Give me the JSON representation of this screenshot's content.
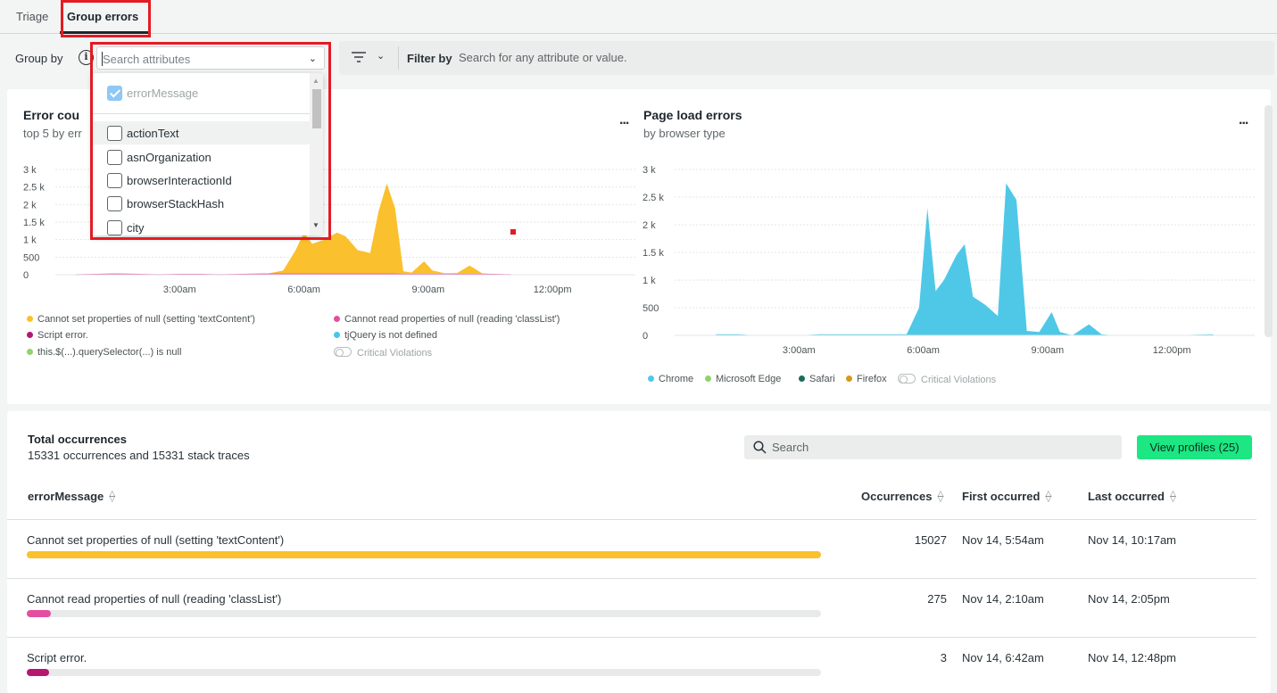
{
  "tabs": [
    {
      "label": "Triage",
      "active": false
    },
    {
      "label": "Group errors",
      "active": true
    }
  ],
  "toolbar": {
    "group_by_label": "Group by",
    "group_by_placeholder": "Search attributes",
    "filter_label": "Filter by",
    "filter_placeholder": "Search for any attribute or value."
  },
  "dropdown": {
    "items": [
      {
        "label": "errorMessage",
        "checked": true,
        "disabled": true
      },
      {
        "label": "actionText",
        "checked": false
      },
      {
        "label": "asnOrganization",
        "checked": false
      },
      {
        "label": "browserInteractionId",
        "checked": false
      },
      {
        "label": "browserStackHash",
        "checked": false
      },
      {
        "label": "city",
        "checked": false
      }
    ]
  },
  "chart_left": {
    "title_visible": "Error cou",
    "subtitle_visible": "top 5 by err",
    "menu": "...",
    "legend": [
      {
        "label": "Cannot set properties of null (setting 'textContent')",
        "color": "#fbc02d"
      },
      {
        "label": "Cannot read properties of null (reading 'classList')",
        "color": "#e34fa0"
      },
      {
        "label": "Script error.",
        "color": "#b5176f"
      },
      {
        "label": "tjQuery is not defined",
        "color": "#46c6e8"
      },
      {
        "label": "this.$(...).querySelector(...) is null",
        "color": "#8fd46a"
      }
    ],
    "toggle_label": "Critical Violations"
  },
  "chart_right": {
    "title": "Page load errors",
    "subtitle": "by browser type",
    "menu": "...",
    "legend": [
      {
        "label": "Chrome",
        "color": "#4fc8e8"
      },
      {
        "label": "Microsoft Edge",
        "color": "#8fd46a"
      },
      {
        "label": "Safari",
        "color": "#1d6b5c"
      },
      {
        "label": "Firefox",
        "color": "#d49a1a"
      }
    ],
    "toggle_label": "Critical Violations"
  },
  "chart_data": [
    {
      "type": "area",
      "title": "Error cou",
      "subtitle": "top 5 by err",
      "ylim": [
        0,
        3000
      ],
      "yticks": [
        "3 k",
        "2.5 k",
        "2 k",
        "1.5 k",
        "1 k",
        "500",
        "0"
      ],
      "xticks": [
        "3:00am",
        "6:00am",
        "9:00am",
        "12:00pm"
      ],
      "x_hours": [
        0.5,
        1,
        1.5,
        2,
        2.5,
        3,
        3.5,
        4,
        4.5,
        5,
        5.5,
        5.8,
        6,
        6.2,
        6.5,
        6.8,
        7,
        7.3,
        7.6,
        7.8,
        8,
        8.2,
        8.4,
        8.6,
        8.9,
        9.1,
        9.4,
        9.7,
        10,
        10.3,
        10.6,
        11
      ],
      "series": [
        {
          "name": "Cannot set properties of null (setting 'textContent')",
          "color": "#fbc02d",
          "values": [
            0,
            0,
            0,
            0,
            0,
            0,
            0,
            0,
            0,
            0,
            120,
            700,
            1200,
            880,
            1000,
            1200,
            1100,
            700,
            620,
            1800,
            2600,
            1900,
            100,
            60,
            380,
            120,
            40,
            50,
            260,
            40,
            20,
            0
          ]
        },
        {
          "name": "Cannot read properties of null (reading 'classList')",
          "color": "#e34fa0",
          "values": [
            0,
            10,
            20,
            10,
            0,
            10,
            10,
            0,
            10,
            20,
            20,
            20,
            20,
            20,
            20,
            20,
            20,
            20,
            20,
            20,
            20,
            20,
            10,
            10,
            10,
            10,
            10,
            10,
            10,
            10,
            10,
            0
          ]
        }
      ]
    },
    {
      "type": "area",
      "title": "Page load errors",
      "subtitle": "by browser type",
      "ylim": [
        0,
        3000
      ],
      "yticks": [
        "3 k",
        "2.5 k",
        "2 k",
        "1.5 k",
        "1 k",
        "500",
        "0"
      ],
      "xticks": [
        "3:00am",
        "6:00am",
        "9:00am",
        "12:00pm"
      ],
      "x_hours": [
        1,
        1.5,
        2,
        2.5,
        3,
        3.5,
        4,
        4.5,
        5,
        5.3,
        5.6,
        5.9,
        6.1,
        6.3,
        6.5,
        6.8,
        7,
        7.2,
        7.5,
        7.8,
        8,
        8.25,
        8.5,
        8.8,
        9.1,
        9.3,
        9.6,
        10,
        10.3,
        10.6,
        11,
        12,
        13
      ],
      "series": [
        {
          "name": "Chrome",
          "color": "#4fc8e8",
          "values": [
            20,
            20,
            0,
            0,
            0,
            20,
            20,
            20,
            20,
            20,
            20,
            500,
            2300,
            800,
            1000,
            1450,
            1650,
            700,
            550,
            350,
            2750,
            2450,
            80,
            60,
            420,
            60,
            0,
            200,
            20,
            0,
            0,
            0,
            20
          ]
        }
      ]
    }
  ],
  "table": {
    "title": "Total occurrences",
    "subtitle": "15331 occurrences and 15331 stack traces",
    "search_placeholder": "Search",
    "view_profiles": "View profiles (25)",
    "headers": {
      "message": "errorMessage",
      "occurrences": "Occurrences",
      "first": "First occurred",
      "last": "Last occurred"
    },
    "rows": [
      {
        "message": "Cannot set properties of null (setting 'textContent')",
        "occurrences": "15027",
        "first": "Nov 14, 5:54am",
        "last": "Nov 14, 10:17am",
        "bar_fraction": 1.0,
        "bar_color": "#fbc02d"
      },
      {
        "message": "Cannot read properties of null (reading 'classList')",
        "occurrences": "275",
        "first": "Nov 14, 2:10am",
        "last": "Nov 14, 2:05pm",
        "bar_fraction": 0.03,
        "bar_color": "#e34fa0"
      },
      {
        "message": "Script error.",
        "occurrences": "3",
        "first": "Nov 14, 6:42am",
        "last": "Nov 14, 12:48pm",
        "bar_fraction": 0.028,
        "bar_color": "#b5176f"
      }
    ]
  }
}
